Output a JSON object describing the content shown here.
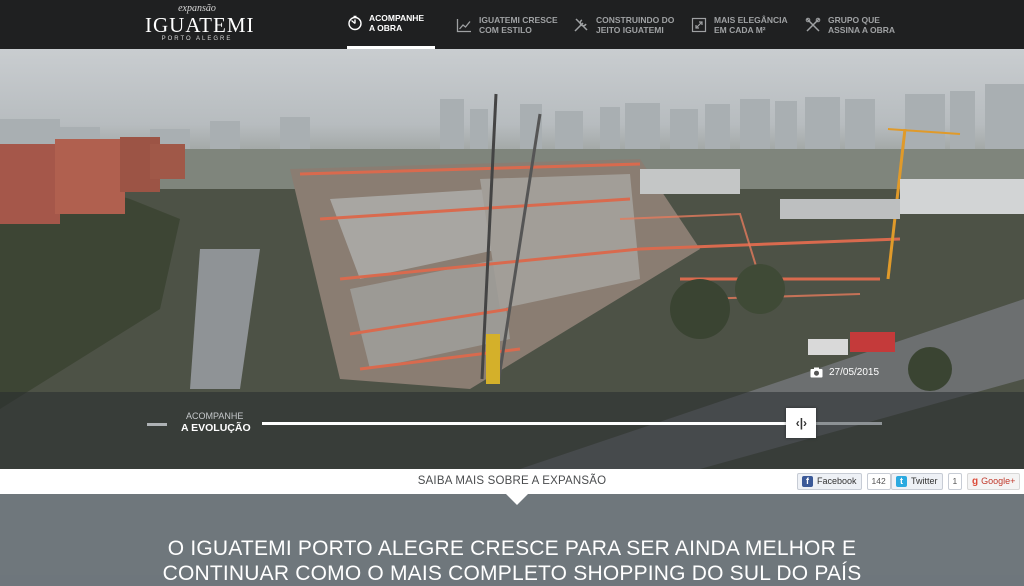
{
  "logo": {
    "pre": "expansão",
    "main": "IGUATEMI",
    "sub": "PORTO ALEGRE"
  },
  "nav": [
    {
      "label": "ACOMPANHE\nA OBRA",
      "icon": "timer-icon",
      "active": true
    },
    {
      "label": "IGUATEMI CRESCE\nCOM ESTILO",
      "icon": "chart-line-icon",
      "active": false
    },
    {
      "label": "CONSTRUINDO DO\nJEITO IGUATEMI",
      "icon": "tools-icon",
      "active": false
    },
    {
      "label": "MAIS ELEGÂNCIA\nEM CADA m²",
      "icon": "expand-icon",
      "active": false
    },
    {
      "label": "GRUPO QUE\nASSINA A OBRA",
      "icon": "cross-tools-icon",
      "active": false
    }
  ],
  "hero": {
    "date": "27/05/2015",
    "timeline": {
      "sub": "ACOMPANHE",
      "main": "A EVOLUÇÃO",
      "progress": 0.87,
      "handle": "‹|›"
    }
  },
  "infobar": {
    "saiba": "SAIBA MAIS SOBRE A EXPANSÃO",
    "facebook": {
      "label": "Facebook",
      "count": "142"
    },
    "twitter": {
      "label": "Twitter",
      "count": "1"
    },
    "google": {
      "label": "Google+"
    }
  },
  "headline": "O IGUATEMI PORTO ALEGRE CRESCE PARA SER AINDA MELHOR E CONTINUAR COMO O MAIS COMPLETO SHOPPING DO SUL DO PAÍS",
  "colors": {
    "topbar": "#1f2021",
    "gray": "#6f777c",
    "facebook": "#3b5998",
    "twitter": "#2aa9e0",
    "google": "#dd4b39"
  }
}
